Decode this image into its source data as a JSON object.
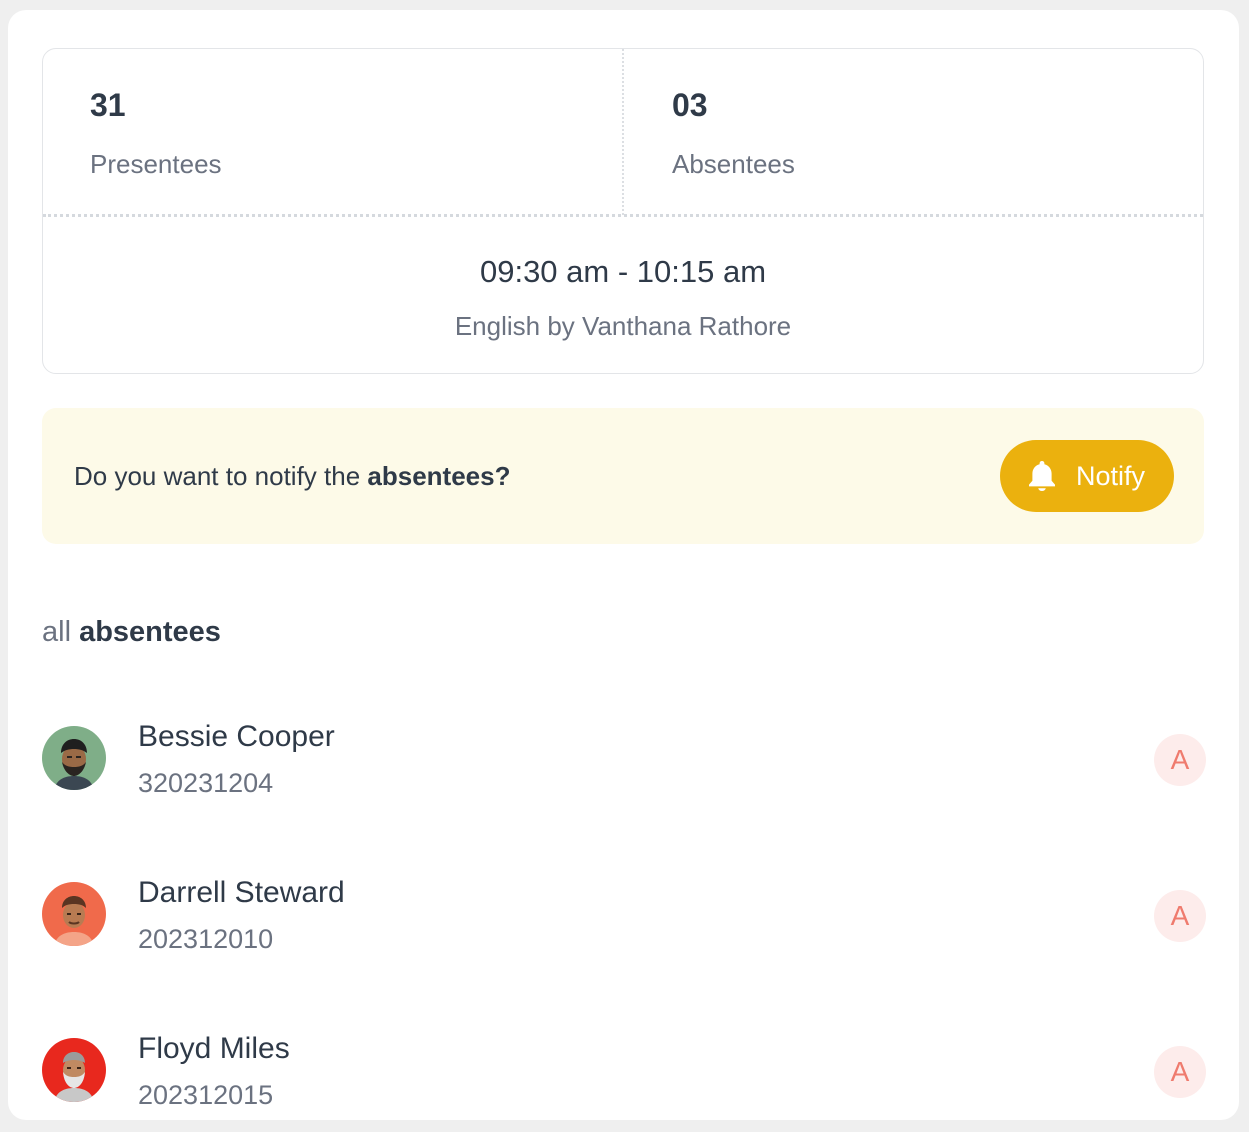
{
  "stats": {
    "presentees": {
      "value": "31",
      "label": "Presentees"
    },
    "absentees": {
      "value": "03",
      "label": "Absentees"
    }
  },
  "session": {
    "time": "09:30 am - 10:15 am",
    "subject": "English by Vanthana Rathore"
  },
  "notify": {
    "prompt_prefix": "Do you want to notify the ",
    "prompt_bold": "absentees?",
    "button_label": "Notify",
    "button_icon": "bell-icon",
    "accent": "#ebb10e"
  },
  "absentees_section": {
    "title_prefix": "all",
    "title_bold": "absentees"
  },
  "students": [
    {
      "name": "Bessie Cooper",
      "id": "320231204",
      "status": "A",
      "avatar_bg": "#7fae88"
    },
    {
      "name": "Darrell Steward",
      "id": "202312010",
      "status": "A",
      "avatar_bg": "#f06a4b"
    },
    {
      "name": "Floyd Miles",
      "id": "202312015",
      "status": "A",
      "avatar_bg": "#e8281e"
    }
  ]
}
